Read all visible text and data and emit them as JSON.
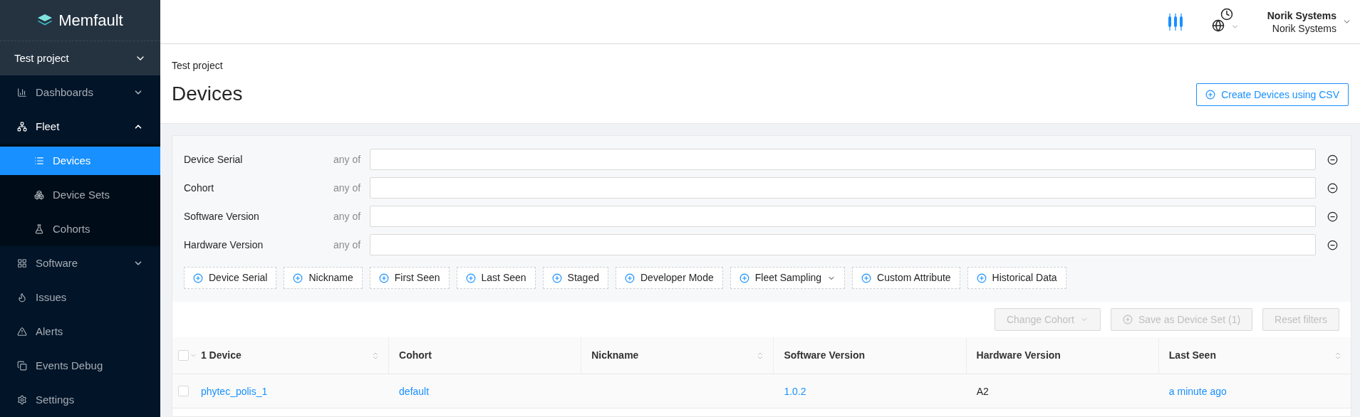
{
  "brand": "Memfault",
  "project": {
    "label": "Test project"
  },
  "nav": [
    {
      "label": "Dashboards",
      "kind": "group",
      "expanded": false,
      "selected": false
    },
    {
      "label": "Fleet",
      "kind": "group",
      "expanded": true,
      "selected": false,
      "children": [
        {
          "label": "Devices",
          "selected": true
        },
        {
          "label": "Device Sets",
          "selected": false
        },
        {
          "label": "Cohorts",
          "selected": false
        }
      ]
    },
    {
      "label": "Software",
      "kind": "group",
      "expanded": false,
      "selected": false
    },
    {
      "label": "Issues",
      "kind": "link",
      "expanded": false,
      "selected": false
    },
    {
      "label": "Alerts",
      "kind": "link",
      "expanded": false,
      "selected": false
    },
    {
      "label": "Events Debug",
      "kind": "link",
      "expanded": false,
      "selected": false
    },
    {
      "label": "Settings",
      "kind": "link",
      "expanded": false,
      "selected": false
    }
  ],
  "account": {
    "org": "Norik Systems",
    "project": "Norik Systems"
  },
  "breadcrumb": "Test project",
  "title": "Devices",
  "create_button": "Create Devices using CSV",
  "filters": [
    {
      "label": "Device Serial",
      "operator": "any of"
    },
    {
      "label": "Cohort",
      "operator": "any of"
    },
    {
      "label": "Software Version",
      "operator": "any of"
    },
    {
      "label": "Hardware Version",
      "operator": "any of"
    }
  ],
  "add_filters": [
    {
      "label": "Device Serial",
      "dropdown": false
    },
    {
      "label": "Nickname",
      "dropdown": false
    },
    {
      "label": "First Seen",
      "dropdown": false
    },
    {
      "label": "Last Seen",
      "dropdown": false
    },
    {
      "label": "Staged",
      "dropdown": false
    },
    {
      "label": "Developer Mode",
      "dropdown": false
    },
    {
      "label": "Fleet Sampling",
      "dropdown": true
    },
    {
      "label": "Custom Attribute",
      "dropdown": false
    },
    {
      "label": "Historical Data",
      "dropdown": false
    }
  ],
  "actions": [
    {
      "label": "Change Cohort",
      "kind": "dropdown",
      "disabled": true
    },
    {
      "label": "Save as Device Set (1)",
      "kind": "add",
      "disabled": true
    },
    {
      "label": "Reset filters",
      "kind": "plain",
      "disabled": true
    }
  ],
  "table": {
    "select_all_checked": false,
    "columns": [
      {
        "label": "1 Device",
        "sortable": true
      },
      {
        "label": "Cohort",
        "sortable": false
      },
      {
        "label": "Nickname",
        "sortable": true
      },
      {
        "label": "Software Version",
        "sortable": false
      },
      {
        "label": "Hardware Version",
        "sortable": false
      },
      {
        "label": "Last Seen",
        "sortable": true
      }
    ],
    "rows": [
      {
        "checked": false,
        "cells": [
          {
            "text": "phytec_polis_1",
            "link": true
          },
          {
            "text": "default",
            "link": true
          },
          null,
          {
            "text": "1.0.2",
            "link": true
          },
          {
            "text": "A2",
            "link": false
          },
          {
            "text": "a minute ago",
            "link": true
          }
        ]
      }
    ]
  }
}
